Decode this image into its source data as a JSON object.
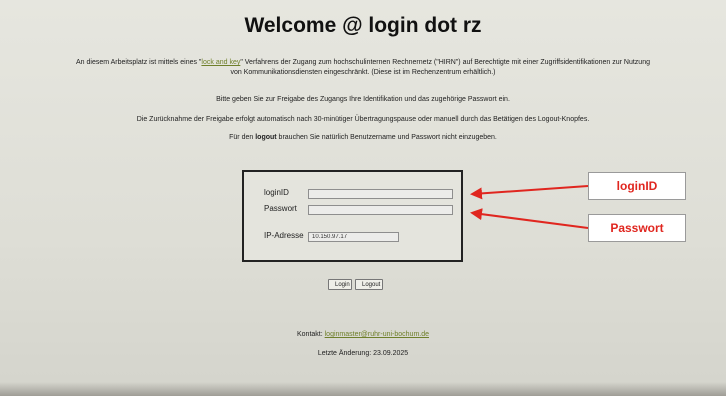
{
  "page": {
    "title": "Welcome @ login dot rz",
    "intro_before": "An diesem Arbeitsplatz ist mittels eines \"",
    "intro_link": "lock and key",
    "intro_after": "\" Verfahrens der Zugang zum hochschulinternen Rechnernetz (\"HIRN\") auf Berechtigte mit einer Zugriffsidentifikationen zur Nutzung",
    "intro_line2": "von Kommunikationsdiensten eingeschränkt. (Diese ist im Rechenzentrum erhältlich.)",
    "instruction": "Bitte geben Sie zur Freigabe des Zugangs Ihre Identifikation und das zugehörige Passwort ein.",
    "revoke_note": "Die Zurücknahme der Freigabe erfolgt automatisch nach 30-minütiger Übertragungspause oder manuell durch das Betätigen des Logout-Knopfes.",
    "logout_note_before": "Für den ",
    "logout_note_bold": "logout",
    "logout_note_after": " brauchen Sie natürlich Benutzername und Passwort nicht einzugeben."
  },
  "form": {
    "loginid_label": "loginID",
    "loginid_value": "",
    "password_label": "Passwort",
    "password_value": "",
    "ip_label": "IP-Adresse",
    "ip_value": "10.150.97.17"
  },
  "buttons": {
    "login": "Login",
    "logout": "Logout"
  },
  "footer": {
    "kontakt_label": "Kontakt: ",
    "kontakt_email": "loginmaster@ruhr-uni-bochum.de",
    "last_change": "Letzte Änderung: 23.09.2025"
  },
  "annotations": {
    "loginid": "loginID",
    "passwort": "Passwort",
    "arrow_color": "#e0261f"
  }
}
